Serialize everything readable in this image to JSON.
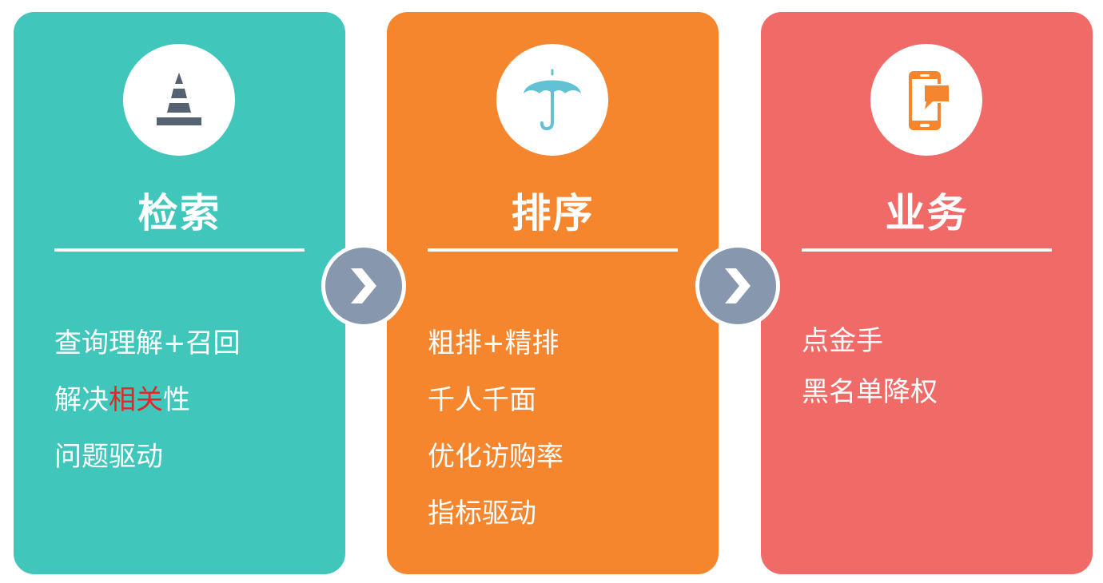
{
  "colors": {
    "card_search": "#40c6bb",
    "card_rank": "#f5862e",
    "card_business": "#f06b67",
    "arrow": "#8797ad",
    "highlight": "#e3262b"
  },
  "cards": [
    {
      "icon": "traffic-cone-icon",
      "title": "检索",
      "items": [
        {
          "segments": [
            "查询理解+召回"
          ]
        },
        {
          "segments": [
            "解决",
            "相关",
            "性"
          ]
        },
        {
          "segments": [
            "问题驱动"
          ]
        }
      ]
    },
    {
      "icon": "umbrella-icon",
      "title": "排序",
      "items": [
        {
          "segments": [
            "粗排+精排"
          ]
        },
        {
          "segments": [
            "千人千面"
          ]
        },
        {
          "segments": [
            "优化访购率"
          ]
        },
        {
          "segments": [
            "指标驱动"
          ]
        }
      ]
    },
    {
      "icon": "mobile-message-icon",
      "title": "业务",
      "items": [
        {
          "segments": [
            "点金手"
          ]
        },
        {
          "segments": [
            "黑名单降权"
          ]
        }
      ]
    }
  ],
  "arrows": [
    "chevron-right-icon",
    "chevron-right-icon"
  ]
}
